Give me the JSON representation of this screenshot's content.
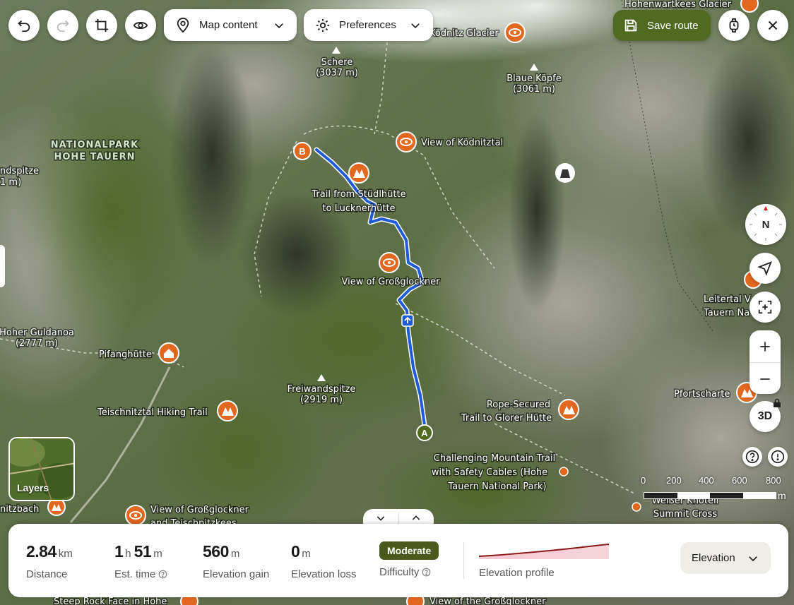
{
  "toolbar": {
    "map_content_label": "Map content",
    "preferences_label": "Preferences",
    "save_route_label": "Save route"
  },
  "map": {
    "region_label_line1": "NATIONALPARK",
    "region_label_line2": "HOHE TAUERN",
    "peaks": [
      {
        "name": "Schere",
        "alt": "(3037 m)"
      },
      {
        "name": "Blaue Köpfe",
        "alt": "(3061 m)"
      },
      {
        "name": "Freiwandspitze",
        "alt": "(2919 m)"
      },
      {
        "name": "Hoher Guldanoa",
        "alt": "(2777 m)"
      }
    ],
    "pois": [
      {
        "line1": "Hohenwartkees Glacier",
        "line2": ""
      },
      {
        "line1": "Ködnitz Glacier",
        "line2": ""
      },
      {
        "line1": "View of Ködnitztal",
        "line2": ""
      },
      {
        "line1": "Trail from Stüdlhütte",
        "line2": "to Lucknerhütte"
      },
      {
        "line1": "View of Großglockner",
        "line2": ""
      },
      {
        "line1": "Pifanghütte",
        "line2": ""
      },
      {
        "line1": "Teischnitztal Hiking Trail",
        "line2": ""
      },
      {
        "line1": "Rope-Secured",
        "line2": "Trail to Glorer Hütte"
      },
      {
        "line1": "Challenging Mountain Trail",
        "line2": "with Safety Cables (Hohe",
        "line3": "Tauern National Park)"
      },
      {
        "line1": "View of Großglockner",
        "line2": "and Teischnitzkees"
      },
      {
        "line1": "Pfortscharte",
        "line2": ""
      },
      {
        "line1": "Leitertal V",
        "line2": "Tauern Na"
      },
      {
        "line1": "Weißer Knotell",
        "line2": "Summit Cross"
      },
      {
        "line1": "Steep Rock Face in Hohe",
        "line2": ""
      },
      {
        "line1": "View of the Großglockner",
        "line2": ""
      },
      {
        "line1": "nitzbach",
        "line2": ""
      },
      {
        "line1": "ndspitze",
        "line2": "1 m)"
      }
    ],
    "route_start_marker": "A",
    "route_end_marker": "B"
  },
  "controls": {
    "compass_label": "N",
    "three_d_label": "3D",
    "layers_label": "Layers"
  },
  "scale": {
    "ticks": [
      "0",
      "200",
      "400",
      "600",
      "800"
    ],
    "unit": "m"
  },
  "stats": {
    "distance": {
      "value": "2.84",
      "unit": "km",
      "label": "Distance"
    },
    "time": {
      "hours": "1",
      "h_unit": "h",
      "minutes": "51",
      "m_unit": "m",
      "label": "Est. time"
    },
    "gain": {
      "value": "560",
      "unit": "m",
      "label": "Elevation gain"
    },
    "loss": {
      "value": "0",
      "unit": "m",
      "label": "Elevation loss"
    },
    "difficulty": {
      "value": "Moderate",
      "label": "Difficulty"
    },
    "profile_label": "Elevation profile",
    "elevation_button": "Elevation"
  },
  "colors": {
    "route": "#1e5bd6",
    "poi": "#e3681f",
    "save_button": "#4f6b1f",
    "difficulty_badge": "#4b5a1c"
  }
}
